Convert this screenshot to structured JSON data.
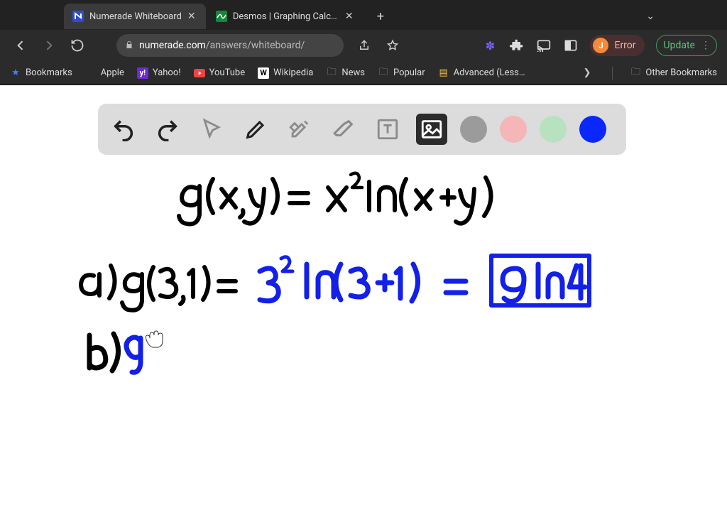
{
  "tabs": {
    "active": {
      "title": "Numerade Whiteboard"
    },
    "second": {
      "title": "Desmos | Graphing Calculato"
    }
  },
  "url": {
    "host": "numerade.com",
    "path": "/answers/whiteboard/"
  },
  "profile": {
    "initial": "J",
    "label": "Error"
  },
  "update": {
    "label": "Update"
  },
  "bookmarks": {
    "b1": "Bookmarks",
    "b2": "Apple",
    "b3": "Yahoo!",
    "b4": "YouTube",
    "b5": "Wikipedia",
    "b6": "News",
    "b7": "Popular",
    "b8": "Advanced (Less…",
    "other": "Other Bookmarks"
  },
  "whiteboard": {
    "tools": {
      "undo": "undo",
      "redo": "redo",
      "select": "select",
      "pen": "pen",
      "tools": "tools",
      "eraser": "eraser",
      "text": "text",
      "image": "image"
    },
    "colors": {
      "gray": "#9b9b9b",
      "pink": "#f4b6b6",
      "green": "#b8e1c0",
      "blue": "#0a27ff"
    },
    "strokes": {
      "definition_black": "g(x,y) = x² ln(x+y)",
      "part_a_label_black": "a) g(3,1) =",
      "part_a_work_blue": "3² ln(3+1) =",
      "part_a_answer_blue": "9 ln 4",
      "part_b_label_black": "b)",
      "part_b_start_blue": "g"
    }
  }
}
